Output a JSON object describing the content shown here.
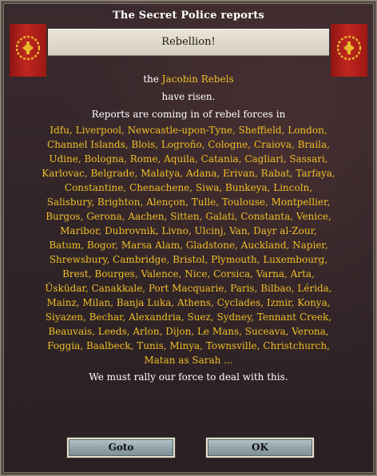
{
  "window": {
    "title": "The Secret Police reports"
  },
  "event": {
    "heading": "Rebellion!"
  },
  "message": {
    "intro_prefix": "the",
    "rebel_group": "Jacobin Rebels",
    "verb_line": "have risen.",
    "reports_line": "Reports are coming in of rebel forces in",
    "locations_lines": [
      "Idfu, Liverpool, Newcastle-upon-Tyne, Sheffield, London,",
      "Channel Islands, Blois, Logroño, Cologne, Craiova, Braila,",
      "Udine, Bologna, Rome, Aquila, Catania, Cagliari, Sassari,",
      "Karlovac, Belgrade, Malatya, Adana, Erivan, Rabat, Tarfaya,",
      "Constantine, Chenachene, Siwa, Bunkeya, Lincoln,",
      "Salisbury, Brighton, Alençon, Tulle, Toulouse, Montpellier,",
      "Burgos, Gerona, Aachen, Sitten, Galati, Constanta, Venice,",
      "Maribor, Dubrovnik, Livno, Ulcinj, Van, Dayr al-Zour,",
      "Batum, Bogor, Marsa Alam, Gladstone, Auckland, Napier,",
      "Shrewsbury, Cambridge, Bristol, Plymouth, Luxembourg,",
      "Brest, Bourges, Valence, Nice, Corsica, Varna, Arta,",
      "Üsküdar, Canakkale, Port Macquarie, Paris, Bilbao, Lérida,",
      "Mainz, Milan, Banja Luka, Athens, Cyclades, Izmir, Konya,",
      "Siyazen, Bechar, Alexandria, Suez, Sydney, Tennant Creek,",
      "Beauvais, Leeds, Arlon, Dijon, Le Mans, Suceava, Verona,",
      "Foggia, Baalbeck, Tunis, Minya, Townsville, Christchurch,",
      "Matan as Sarah ..."
    ],
    "closing": "We must rally our force to deal with this."
  },
  "buttons": {
    "goto_label": "Goto",
    "ok_label": "OK"
  },
  "colors": {
    "gold_text": "#f0bf26",
    "banner_red": "#c02620",
    "panel": "#2e2326"
  },
  "icons": {
    "banner_emblem": "laurel-wreath-eagle-icon"
  }
}
